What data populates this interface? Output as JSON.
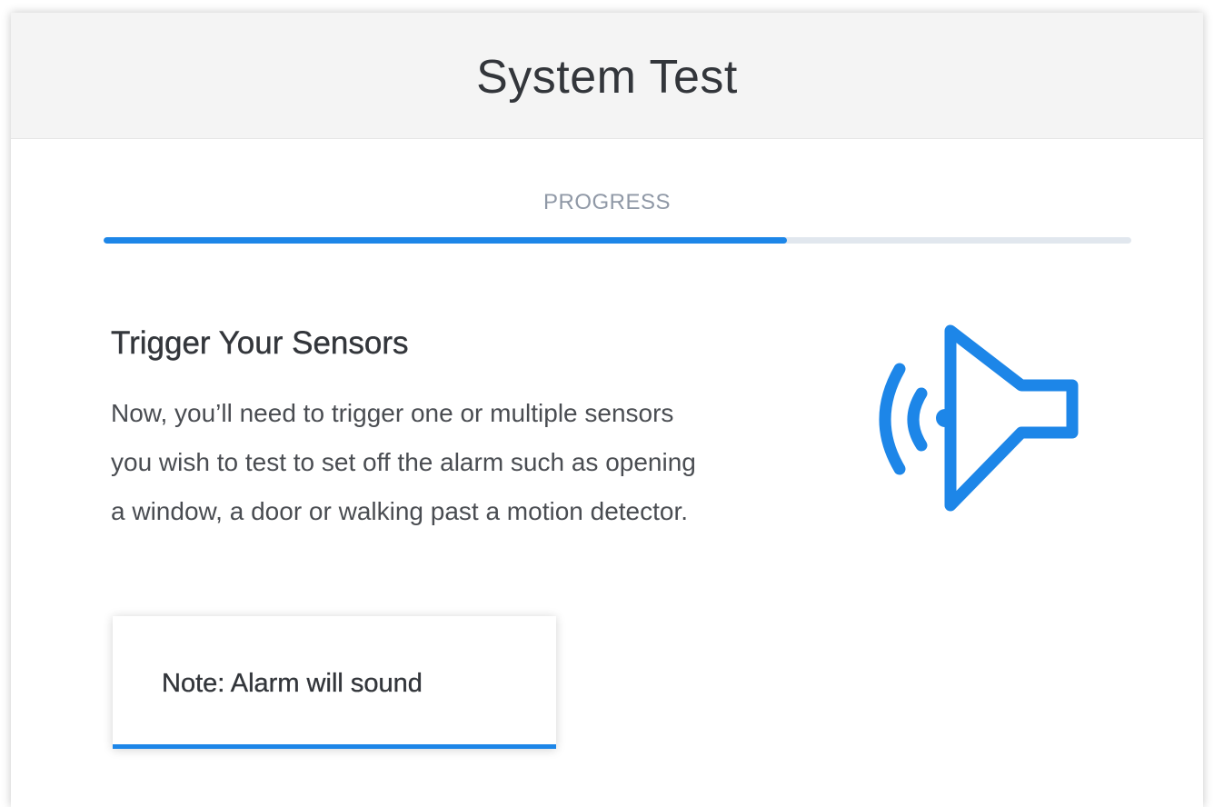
{
  "header": {
    "title": "System Test"
  },
  "progress": {
    "label": "PROGRESS",
    "value": 0.665
  },
  "step": {
    "title": "Trigger Your Sensors",
    "description": "Now, you’ll need to trigger one or multiple sensors you wish to test to set off the alarm such as opening a window, a door or walking past a motion detector.",
    "icon": "speaker-sound-icon"
  },
  "note": {
    "text": "Note: Alarm will sound"
  },
  "colors": {
    "accent": "#1d86e8",
    "track": "#e1e7ee",
    "header_bg": "#f4f4f4"
  }
}
